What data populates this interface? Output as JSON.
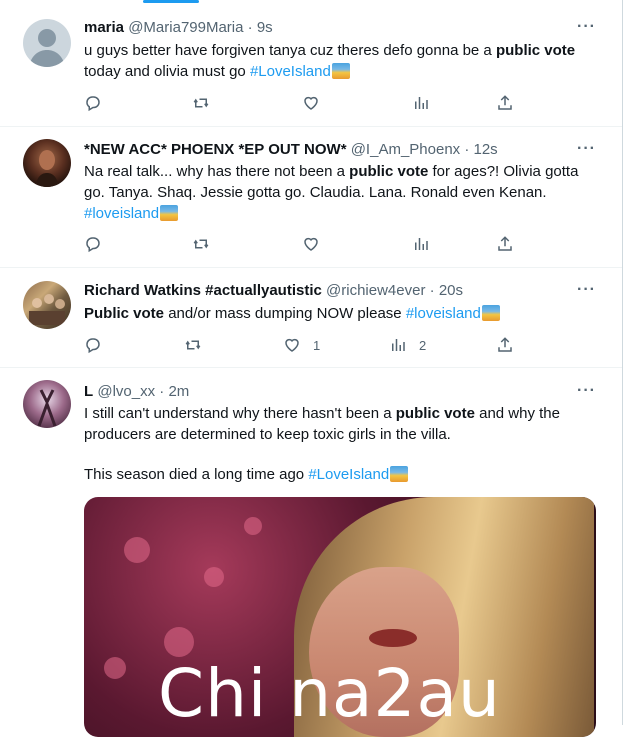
{
  "tweets": [
    {
      "name": "maria",
      "handle": "@Maria799Maria",
      "time": "9s",
      "text_line1_a": "u guys better have forgiven tanya cuz theres defo gonna be a ",
      "text_line1_b": "public vote",
      "text_line2_a": "today and olivia must go ",
      "hashtag": "#LoveIsland",
      "reply_count": "",
      "retweet_count": "",
      "like_count": "",
      "view_count": ""
    },
    {
      "name": "*NEW ACC* PHOENX *EP OUT NOW*",
      "handle": "@I_Am_Phoenx",
      "time": "12s",
      "text_line1_a": "Na real talk... why has there not been a ",
      "text_line1_b": "public vote",
      "text_line1_c": " for ages?! Olivia gotta",
      "text_line2": "go. Tanya. Shaq. Jessie gotta go. Claudia. Lana. Ronald even Kenan.",
      "hashtag": "#loveisland"
    },
    {
      "name": "Richard Watkins #actuallyautistic",
      "handle": "@richiew4ever",
      "time": "20s",
      "text_bold": "Public vote",
      "text_rest": " and/or mass dumping NOW please ",
      "hashtag": "#loveisland",
      "like_count": "1",
      "view_count": "2"
    },
    {
      "name": "L",
      "handle": "@lvo_xx",
      "time": "2m",
      "text_line1_a": "I still can't understand why there hasn't been a ",
      "text_line1_b": "public vote",
      "text_line1_c": " and why the",
      "text_line2": "producers are determined to keep toxic girls in the villa.",
      "text_line3": "This season died a long time ago ",
      "hashtag": "#LoveIsland"
    }
  ],
  "separator": " · ",
  "more_label": "···",
  "watermark": "Chi na2au",
  "icons": [
    "reply-icon",
    "retweet-icon",
    "like-icon",
    "views-icon",
    "share-icon"
  ],
  "colors": {
    "accent": "#1d9bf0",
    "secondary_text": "#536471",
    "text": "#0f1419"
  }
}
